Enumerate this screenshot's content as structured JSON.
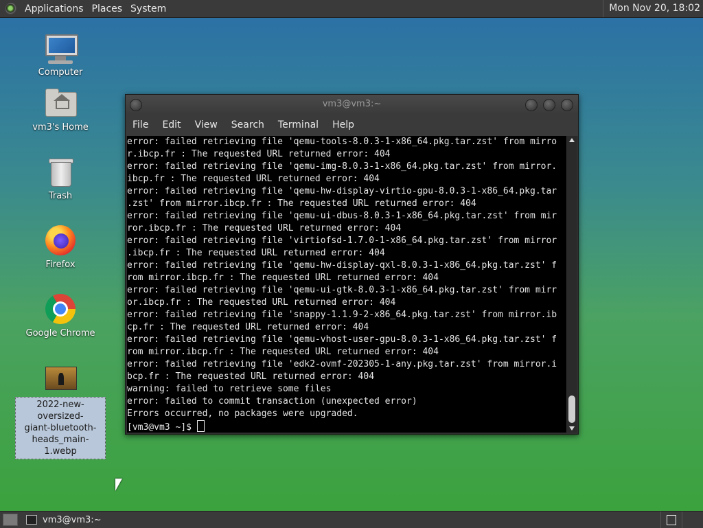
{
  "top_panel": {
    "menus": [
      "Applications",
      "Places",
      "System"
    ],
    "clock": "Mon Nov 20, 18:02"
  },
  "desktop_icons": [
    {
      "label": "Computer",
      "icon": "computer-icon"
    },
    {
      "label": "vm3's Home",
      "icon": "home-folder-icon"
    },
    {
      "label": "Trash",
      "icon": "trash-icon"
    },
    {
      "label": "Firefox",
      "icon": "firefox-icon"
    },
    {
      "label": "Google Chrome",
      "icon": "chrome-icon"
    },
    {
      "label": "2022-new-oversized-giant-bluetooth-heads_main-1.webp",
      "label_lines": [
        "2022-new-oversized-",
        "giant-bluetooth-",
        "heads_main-1.webp"
      ],
      "icon": "image-file-icon",
      "selected": true
    }
  ],
  "terminal_window": {
    "title": "vm3@vm3:~",
    "menu": [
      "File",
      "Edit",
      "View",
      "Search",
      "Terminal",
      "Help"
    ],
    "lines": [
      "error: failed retrieving file 'qemu-tools-8.0.3-1-x86_64.pkg.tar.zst' from mirro",
      "r.ibcp.fr : The requested URL returned error: 404",
      "error: failed retrieving file 'qemu-img-8.0.3-1-x86_64.pkg.tar.zst' from mirror.",
      "ibcp.fr : The requested URL returned error: 404",
      "error: failed retrieving file 'qemu-hw-display-virtio-gpu-8.0.3-1-x86_64.pkg.tar",
      ".zst' from mirror.ibcp.fr : The requested URL returned error: 404",
      "error: failed retrieving file 'qemu-ui-dbus-8.0.3-1-x86_64.pkg.tar.zst' from mir",
      "ror.ibcp.fr : The requested URL returned error: 404",
      "error: failed retrieving file 'virtiofsd-1.7.0-1-x86_64.pkg.tar.zst' from mirror",
      ".ibcp.fr : The requested URL returned error: 404",
      "error: failed retrieving file 'qemu-hw-display-qxl-8.0.3-1-x86_64.pkg.tar.zst' f",
      "rom mirror.ibcp.fr : The requested URL returned error: 404",
      "error: failed retrieving file 'qemu-ui-gtk-8.0.3-1-x86_64.pkg.tar.zst' from mirr",
      "or.ibcp.fr : The requested URL returned error: 404",
      "error: failed retrieving file 'snappy-1.1.9-2-x86_64.pkg.tar.zst' from mirror.ib",
      "cp.fr : The requested URL returned error: 404",
      "error: failed retrieving file 'qemu-vhost-user-gpu-8.0.3-1-x86_64.pkg.tar.zst' f",
      "rom mirror.ibcp.fr : The requested URL returned error: 404",
      "error: failed retrieving file 'edk2-ovmf-202305-1-any.pkg.tar.zst' from mirror.i",
      "bcp.fr : The requested URL returned error: 404",
      "warning: failed to retrieve some files",
      "error: failed to commit transaction (unexpected error)",
      "Errors occurred, no packages were upgraded."
    ],
    "prompt": "[vm3@vm3 ~]$ "
  },
  "bottom_panel": {
    "task_label": "vm3@vm3:~"
  }
}
